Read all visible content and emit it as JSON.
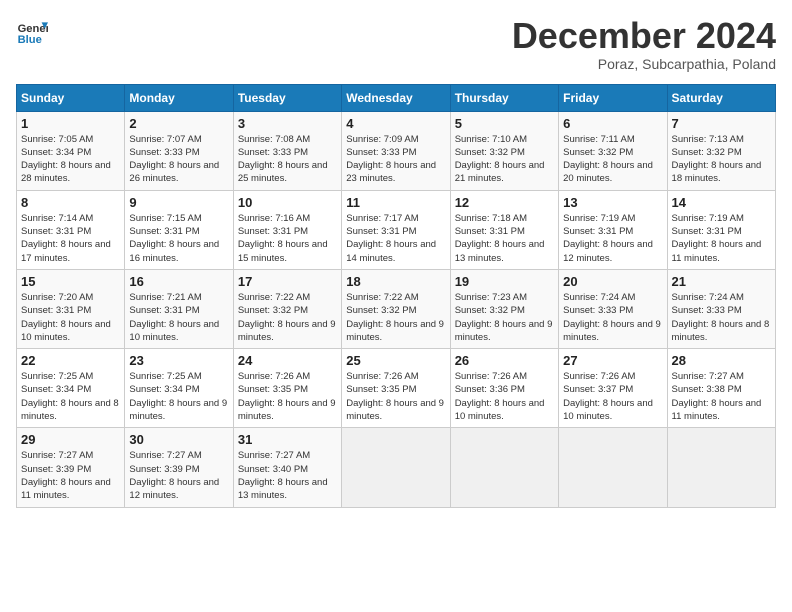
{
  "header": {
    "logo_line1": "General",
    "logo_line2": "Blue",
    "month": "December 2024",
    "location": "Poraz, Subcarpathia, Poland"
  },
  "days_of_week": [
    "Sunday",
    "Monday",
    "Tuesday",
    "Wednesday",
    "Thursday",
    "Friday",
    "Saturday"
  ],
  "weeks": [
    [
      {
        "day": "1",
        "sunrise": "Sunrise: 7:05 AM",
        "sunset": "Sunset: 3:34 PM",
        "daylight": "Daylight: 8 hours and 28 minutes."
      },
      {
        "day": "2",
        "sunrise": "Sunrise: 7:07 AM",
        "sunset": "Sunset: 3:33 PM",
        "daylight": "Daylight: 8 hours and 26 minutes."
      },
      {
        "day": "3",
        "sunrise": "Sunrise: 7:08 AM",
        "sunset": "Sunset: 3:33 PM",
        "daylight": "Daylight: 8 hours and 25 minutes."
      },
      {
        "day": "4",
        "sunrise": "Sunrise: 7:09 AM",
        "sunset": "Sunset: 3:33 PM",
        "daylight": "Daylight: 8 hours and 23 minutes."
      },
      {
        "day": "5",
        "sunrise": "Sunrise: 7:10 AM",
        "sunset": "Sunset: 3:32 PM",
        "daylight": "Daylight: 8 hours and 21 minutes."
      },
      {
        "day": "6",
        "sunrise": "Sunrise: 7:11 AM",
        "sunset": "Sunset: 3:32 PM",
        "daylight": "Daylight: 8 hours and 20 minutes."
      },
      {
        "day": "7",
        "sunrise": "Sunrise: 7:13 AM",
        "sunset": "Sunset: 3:32 PM",
        "daylight": "Daylight: 8 hours and 18 minutes."
      }
    ],
    [
      {
        "day": "8",
        "sunrise": "Sunrise: 7:14 AM",
        "sunset": "Sunset: 3:31 PM",
        "daylight": "Daylight: 8 hours and 17 minutes."
      },
      {
        "day": "9",
        "sunrise": "Sunrise: 7:15 AM",
        "sunset": "Sunset: 3:31 PM",
        "daylight": "Daylight: 8 hours and 16 minutes."
      },
      {
        "day": "10",
        "sunrise": "Sunrise: 7:16 AM",
        "sunset": "Sunset: 3:31 PM",
        "daylight": "Daylight: 8 hours and 15 minutes."
      },
      {
        "day": "11",
        "sunrise": "Sunrise: 7:17 AM",
        "sunset": "Sunset: 3:31 PM",
        "daylight": "Daylight: 8 hours and 14 minutes."
      },
      {
        "day": "12",
        "sunrise": "Sunrise: 7:18 AM",
        "sunset": "Sunset: 3:31 PM",
        "daylight": "Daylight: 8 hours and 13 minutes."
      },
      {
        "day": "13",
        "sunrise": "Sunrise: 7:19 AM",
        "sunset": "Sunset: 3:31 PM",
        "daylight": "Daylight: 8 hours and 12 minutes."
      },
      {
        "day": "14",
        "sunrise": "Sunrise: 7:19 AM",
        "sunset": "Sunset: 3:31 PM",
        "daylight": "Daylight: 8 hours and 11 minutes."
      }
    ],
    [
      {
        "day": "15",
        "sunrise": "Sunrise: 7:20 AM",
        "sunset": "Sunset: 3:31 PM",
        "daylight": "Daylight: 8 hours and 10 minutes."
      },
      {
        "day": "16",
        "sunrise": "Sunrise: 7:21 AM",
        "sunset": "Sunset: 3:31 PM",
        "daylight": "Daylight: 8 hours and 10 minutes."
      },
      {
        "day": "17",
        "sunrise": "Sunrise: 7:22 AM",
        "sunset": "Sunset: 3:32 PM",
        "daylight": "Daylight: 8 hours and 9 minutes."
      },
      {
        "day": "18",
        "sunrise": "Sunrise: 7:22 AM",
        "sunset": "Sunset: 3:32 PM",
        "daylight": "Daylight: 8 hours and 9 minutes."
      },
      {
        "day": "19",
        "sunrise": "Sunrise: 7:23 AM",
        "sunset": "Sunset: 3:32 PM",
        "daylight": "Daylight: 8 hours and 9 minutes."
      },
      {
        "day": "20",
        "sunrise": "Sunrise: 7:24 AM",
        "sunset": "Sunset: 3:33 PM",
        "daylight": "Daylight: 8 hours and 9 minutes."
      },
      {
        "day": "21",
        "sunrise": "Sunrise: 7:24 AM",
        "sunset": "Sunset: 3:33 PM",
        "daylight": "Daylight: 8 hours and 8 minutes."
      }
    ],
    [
      {
        "day": "22",
        "sunrise": "Sunrise: 7:25 AM",
        "sunset": "Sunset: 3:34 PM",
        "daylight": "Daylight: 8 hours and 8 minutes."
      },
      {
        "day": "23",
        "sunrise": "Sunrise: 7:25 AM",
        "sunset": "Sunset: 3:34 PM",
        "daylight": "Daylight: 8 hours and 9 minutes."
      },
      {
        "day": "24",
        "sunrise": "Sunrise: 7:26 AM",
        "sunset": "Sunset: 3:35 PM",
        "daylight": "Daylight: 8 hours and 9 minutes."
      },
      {
        "day": "25",
        "sunrise": "Sunrise: 7:26 AM",
        "sunset": "Sunset: 3:35 PM",
        "daylight": "Daylight: 8 hours and 9 minutes."
      },
      {
        "day": "26",
        "sunrise": "Sunrise: 7:26 AM",
        "sunset": "Sunset: 3:36 PM",
        "daylight": "Daylight: 8 hours and 10 minutes."
      },
      {
        "day": "27",
        "sunrise": "Sunrise: 7:26 AM",
        "sunset": "Sunset: 3:37 PM",
        "daylight": "Daylight: 8 hours and 10 minutes."
      },
      {
        "day": "28",
        "sunrise": "Sunrise: 7:27 AM",
        "sunset": "Sunset: 3:38 PM",
        "daylight": "Daylight: 8 hours and 11 minutes."
      }
    ],
    [
      {
        "day": "29",
        "sunrise": "Sunrise: 7:27 AM",
        "sunset": "Sunset: 3:39 PM",
        "daylight": "Daylight: 8 hours and 11 minutes."
      },
      {
        "day": "30",
        "sunrise": "Sunrise: 7:27 AM",
        "sunset": "Sunset: 3:39 PM",
        "daylight": "Daylight: 8 hours and 12 minutes."
      },
      {
        "day": "31",
        "sunrise": "Sunrise: 7:27 AM",
        "sunset": "Sunset: 3:40 PM",
        "daylight": "Daylight: 8 hours and 13 minutes."
      },
      null,
      null,
      null,
      null
    ]
  ]
}
